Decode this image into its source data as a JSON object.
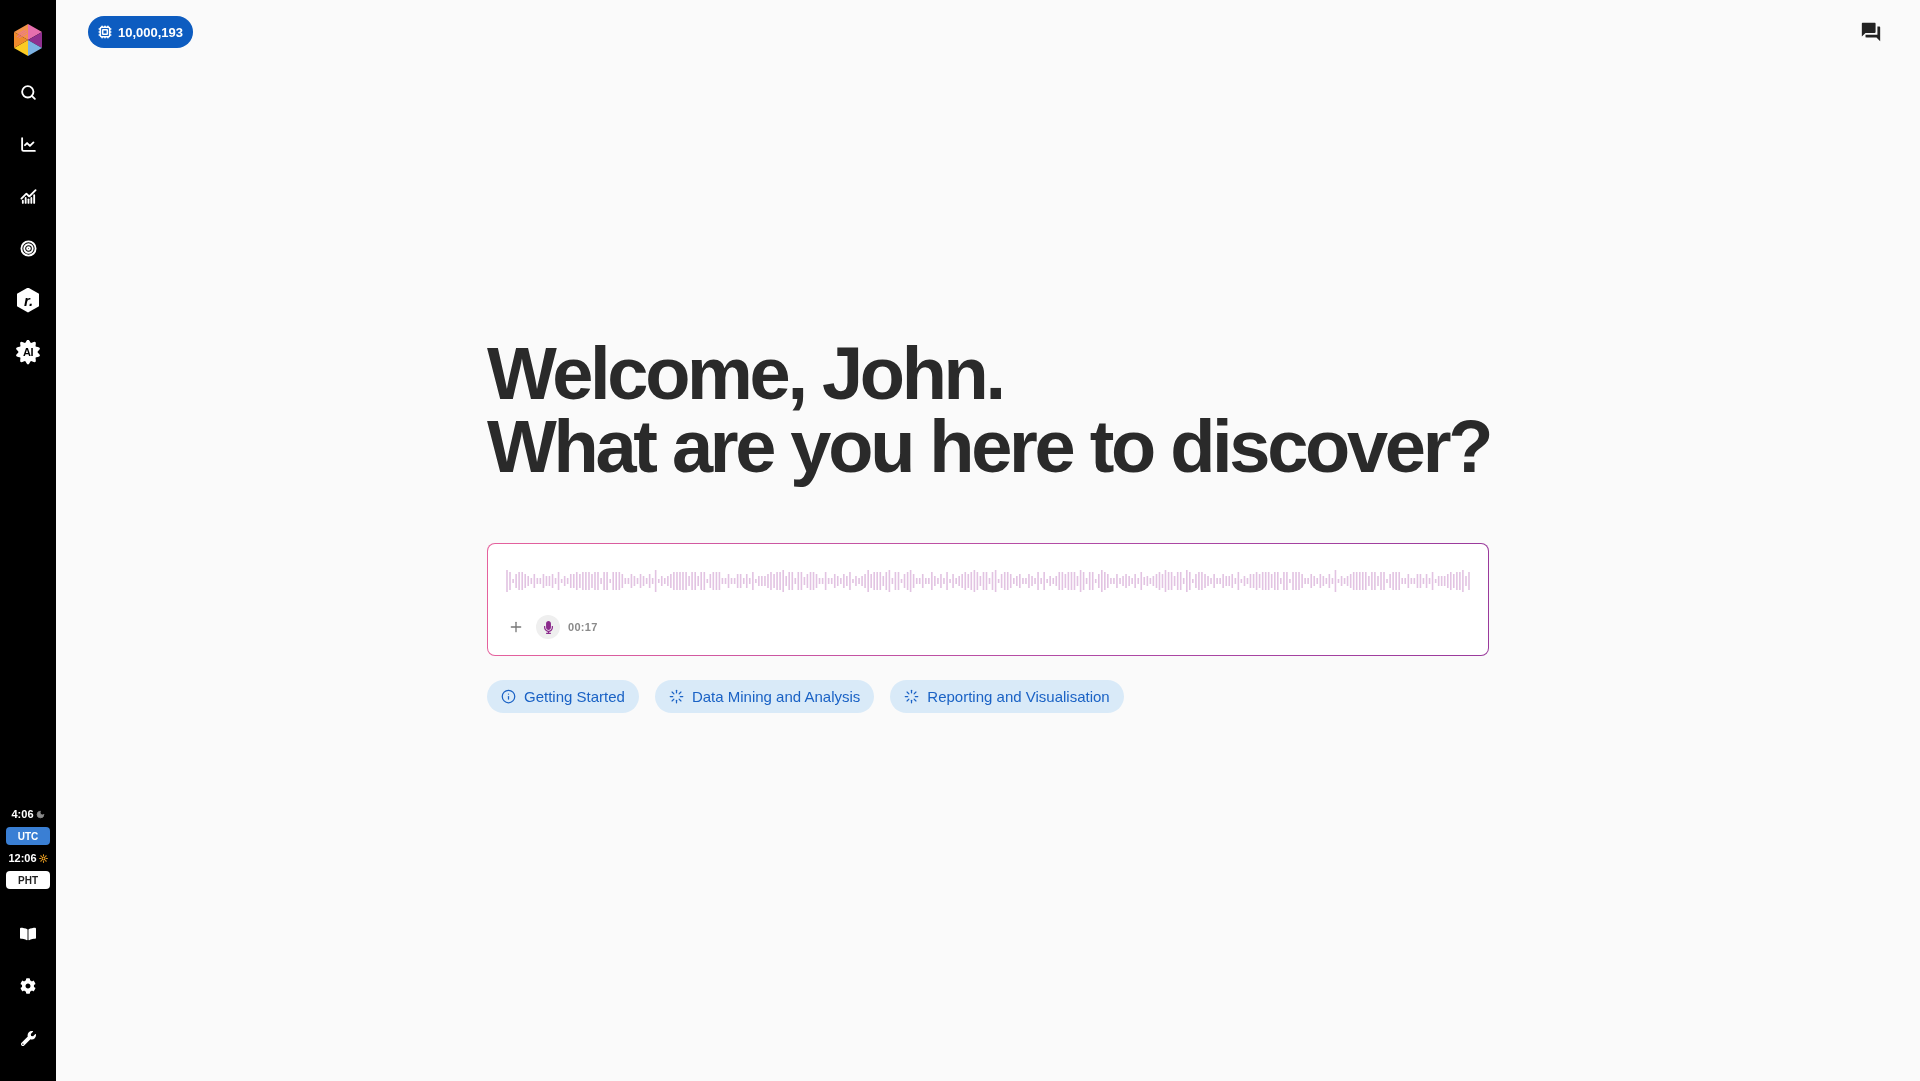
{
  "sidebar": {
    "hexagon_mark": "r.",
    "gear_mark": "AI",
    "clocks": [
      {
        "time": "4:06",
        "kind": "night",
        "zone": "UTC",
        "selected": true
      },
      {
        "time": "12:06",
        "kind": "day",
        "zone": "PHT",
        "selected": false
      }
    ]
  },
  "credits_badge": "10,000,193",
  "heading": [
    "Welcome, John.",
    "What are you here to discover?"
  ],
  "composer": {
    "recording": true,
    "timer": "00:17"
  },
  "suggestions": [
    {
      "kind": "info",
      "label": "Getting Started"
    },
    {
      "kind": "burst",
      "label": "Data Mining and Analysis"
    },
    {
      "kind": "burst",
      "label": "Reporting and Visualisation"
    }
  ]
}
